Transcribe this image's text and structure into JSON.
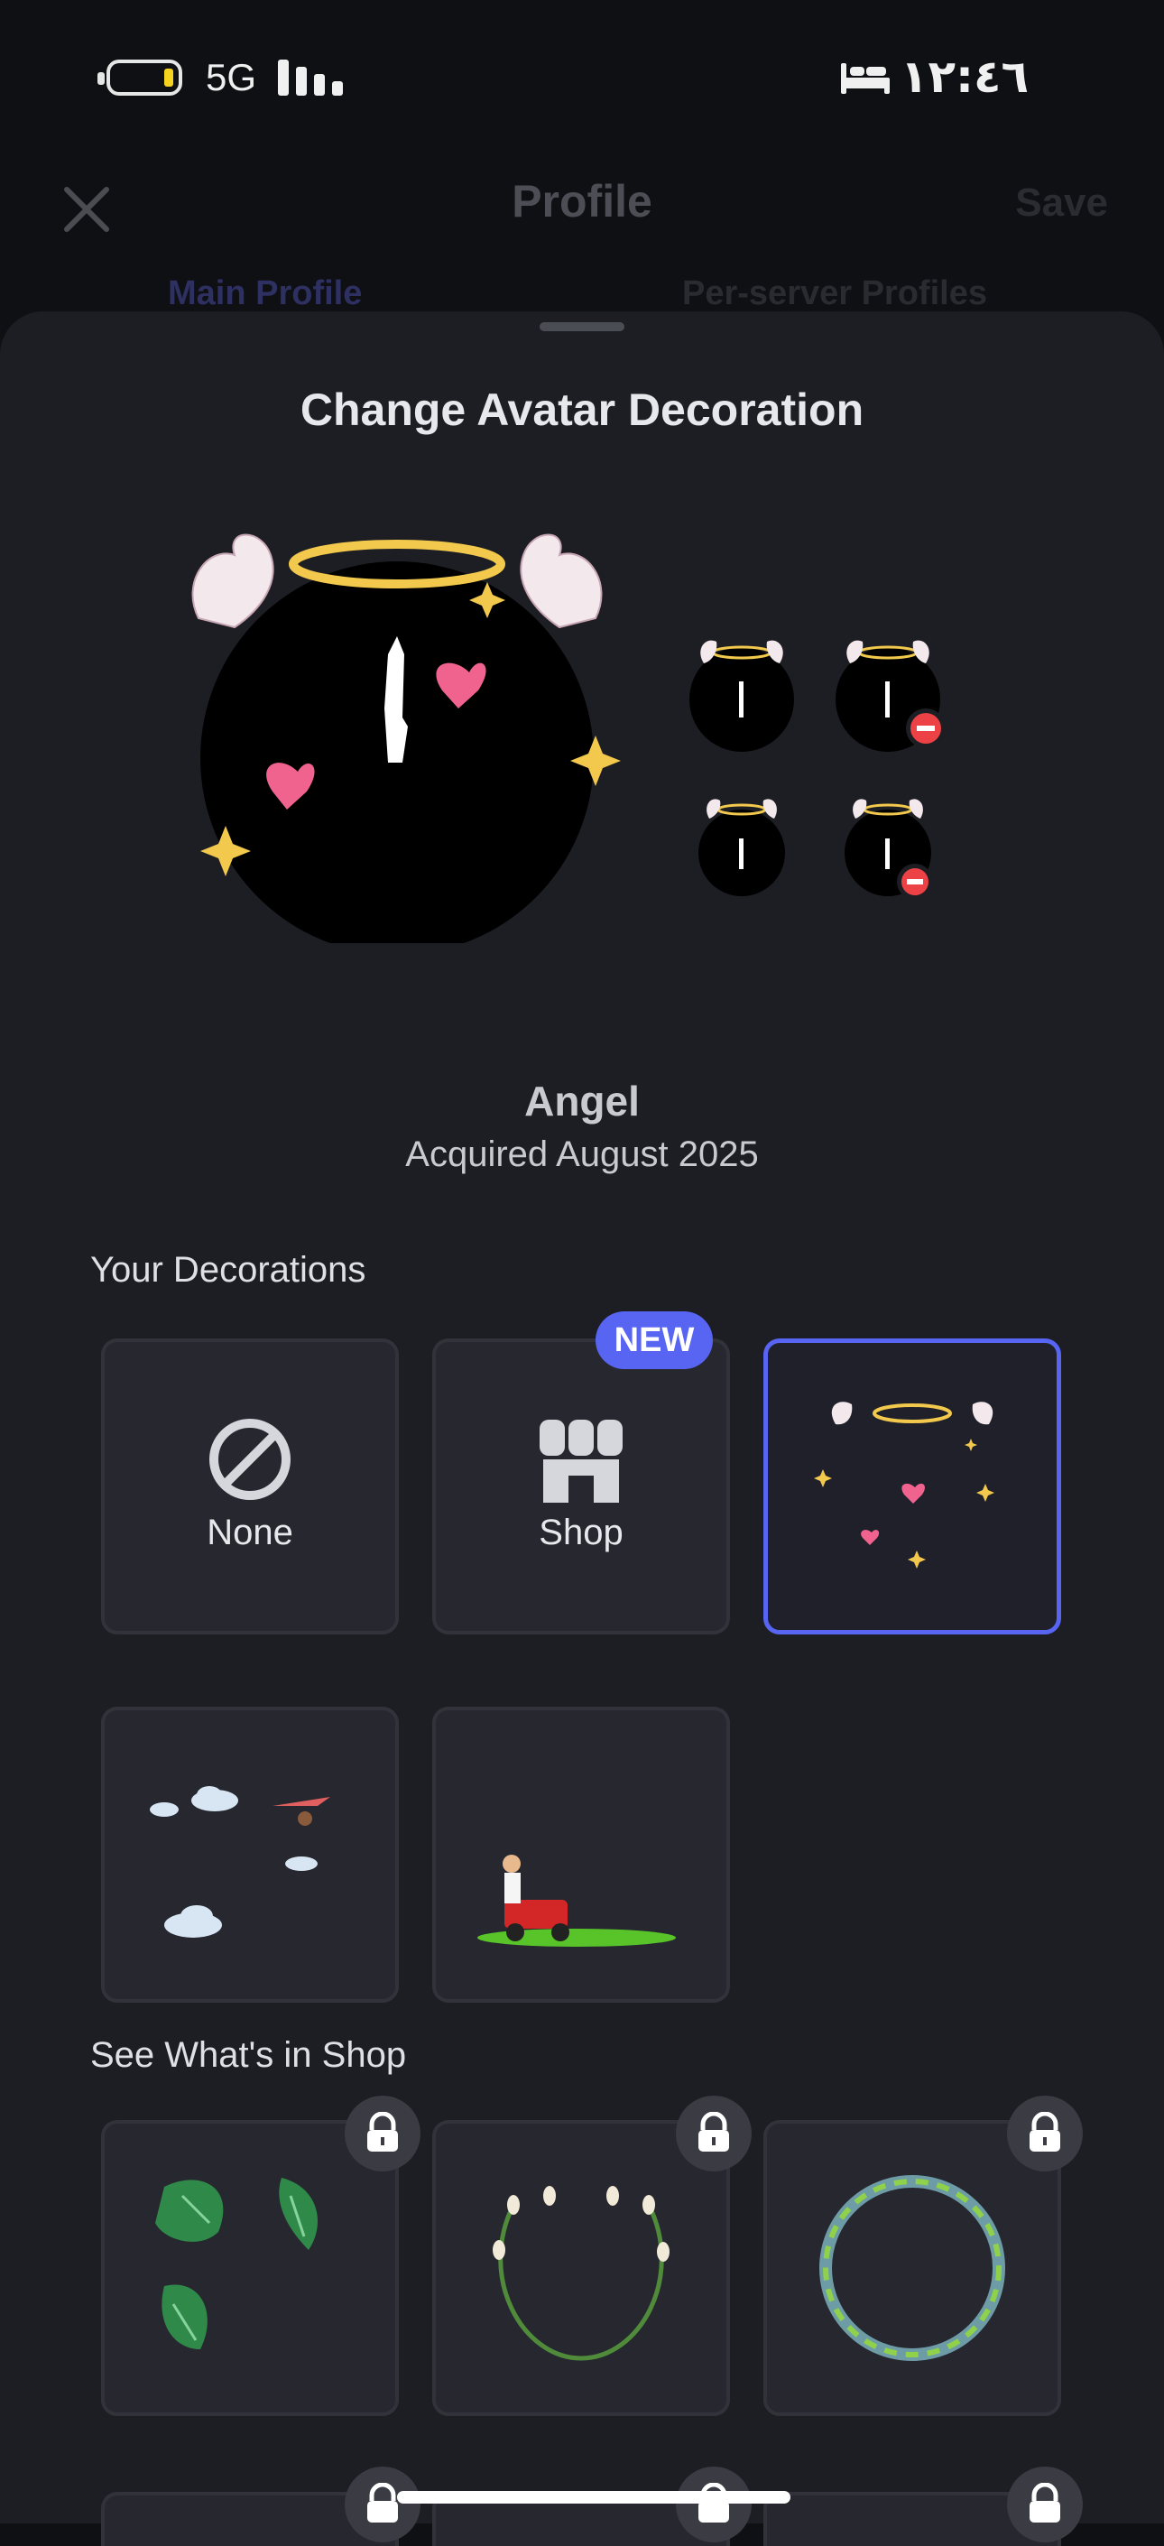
{
  "status_bar": {
    "network": "5G",
    "time": "١٢:٤٦",
    "battery_level": 0.15
  },
  "header": {
    "close_icon": "close-icon",
    "title": "Profile",
    "save_label": "Save",
    "tabs": [
      {
        "label": "Main Profile",
        "active": true
      },
      {
        "label": "Per-server Profiles",
        "active": false
      }
    ]
  },
  "sheet": {
    "title": "Change Avatar Decoration",
    "selected_decoration": {
      "name": "Angel",
      "acquired": "Acquired August 2025"
    },
    "your_decorations_label": "Your Decorations",
    "tiles": [
      {
        "label": "None",
        "icon": "none-icon"
      },
      {
        "label": "Shop",
        "icon": "shop-icon",
        "badge": "NEW"
      },
      {
        "label": "",
        "icon": "angel-decoration",
        "selected": true
      },
      {
        "label": "",
        "icon": "clouds-glider-decoration"
      },
      {
        "label": "",
        "icon": "lawnmower-decoration"
      }
    ],
    "shop_label": "See What's in Shop",
    "shop_tiles": [
      {
        "icon": "leaves-decoration",
        "locked": true
      },
      {
        "icon": "flower-vine-decoration",
        "locked": true
      },
      {
        "icon": "glowing-vine-ring-decoration",
        "locked": true
      }
    ]
  },
  "colors": {
    "accent": "#5865f2",
    "sheet_bg": "#1d1e24",
    "tile_bg": "#26272f"
  }
}
